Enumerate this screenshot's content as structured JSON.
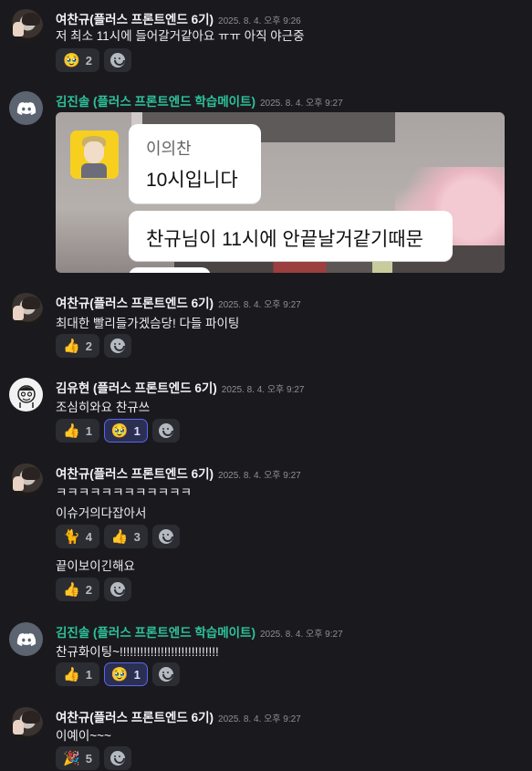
{
  "messages": [
    {
      "author": "여찬규(플러스 프론트엔드 6기)",
      "time": "2025. 8. 4. 오후 9:26",
      "lines": [
        "저 최소 11시에 들어갈거같아요 ㅠㅠ 아직 야근중"
      ],
      "reactions": [
        {
          "emoji": "🥹",
          "count": "2"
        }
      ]
    },
    {
      "author": "김진솔 (플러스 프론트엔드 학습메이트)",
      "time": "2025. 8. 4. 오후 9:27",
      "image": {
        "speaker": "이의찬",
        "bubble1": "10시입니다",
        "bubble2": "찬규님이 11시에 안끝날거같기때문"
      }
    },
    {
      "author": "여찬규(플러스 프론트엔드 6기)",
      "time": "2025. 8. 4. 오후 9:27",
      "lines": [
        "최대한 빨리들가겠슴당! 다들 파이팅"
      ],
      "reactions": [
        {
          "emoji": "👍",
          "count": "2"
        }
      ]
    },
    {
      "author": "김유현 (플러스 프론트엔드 6기)",
      "time": "2025. 8. 4. 오후 9:27",
      "lines": [
        "조심히와요 찬규쓰"
      ],
      "reactions": [
        {
          "emoji": "👍",
          "count": "1"
        },
        {
          "emoji": "🥹",
          "count": "1"
        }
      ]
    },
    {
      "author": "여찬규(플러스 프론트엔드 6기)",
      "time": "2025. 8. 4. 오후 9:27",
      "lines": [
        "ㅋㅋㅋㅋㅋㅋㅋㅋㅋㅋㅋㅋ",
        "이슈거의다잡아서",
        "끝이보이긴해요"
      ],
      "reactions": [
        {
          "emoji": "🐈",
          "count": "4"
        },
        {
          "emoji": "👍",
          "count": "3"
        }
      ],
      "reactions2": [
        {
          "emoji": "👍",
          "count": "2"
        }
      ]
    },
    {
      "author": "김진솔 (플러스 프론트엔드 학습메이트)",
      "time": "2025. 8. 4. 오후 9:27",
      "lines": [
        "찬규화이팅~!!!!!!!!!!!!!!!!!!!!!!!!!!!!!"
      ],
      "reactions": [
        {
          "emoji": "👍",
          "count": "1"
        },
        {
          "emoji": "🥹",
          "count": "1"
        }
      ]
    },
    {
      "author": "여찬규(플러스 프론트엔드 6기)",
      "time": "2025. 8. 4. 오후 9:27",
      "lines": [
        "이예이~~~"
      ],
      "reactions": [
        {
          "emoji": "🎉",
          "count": "5"
        }
      ]
    }
  ]
}
